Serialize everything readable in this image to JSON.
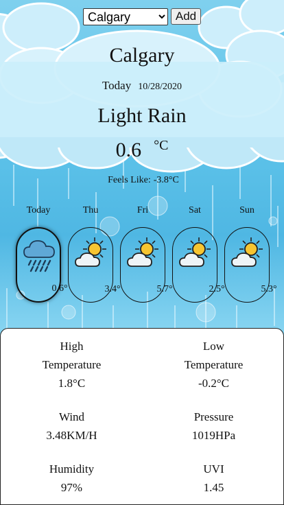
{
  "header": {
    "city_select_value": "Calgary",
    "add_label": "Add"
  },
  "current": {
    "city": "Calgary",
    "day_label": "Today",
    "date": "10/28/2020",
    "condition": "Light Rain",
    "temp": "0.6",
    "unit": "°C",
    "feels_label": "Feels Like:",
    "feels_value": "-3.8°C",
    "icon": "rain-cloud-icon"
  },
  "forecast": [
    {
      "day": "Today",
      "temp": "0.6°",
      "icon": "rain-cloud-icon"
    },
    {
      "day": "Thu",
      "temp": "3.4°",
      "icon": "partly-cloudy-icon"
    },
    {
      "day": "Fri",
      "temp": "5.7°",
      "icon": "partly-cloudy-icon"
    },
    {
      "day": "Sat",
      "temp": "2.5°",
      "icon": "partly-cloudy-icon"
    },
    {
      "day": "Sun",
      "temp": "5.3°",
      "icon": "partly-cloudy-icon"
    }
  ],
  "details": {
    "high_label_1": "High",
    "high_label_2": "Temperature",
    "high_value": "1.8°C",
    "low_label_1": "Low",
    "low_label_2": "Temperature",
    "low_value": "-0.2°C",
    "wind_label": "Wind",
    "wind_value": "3.48KM/H",
    "pressure_label": "Pressure",
    "pressure_value": "1019HPa",
    "humidity_label": "Humidity",
    "humidity_value": "97%",
    "uvi_label": "UVI",
    "uvi_value": "1.45"
  },
  "colors": {
    "sky": "#5fc4ea",
    "cloud": "#bfe8f8",
    "sun": "#f7c531",
    "rain_cloud": "#5fa8d6"
  }
}
